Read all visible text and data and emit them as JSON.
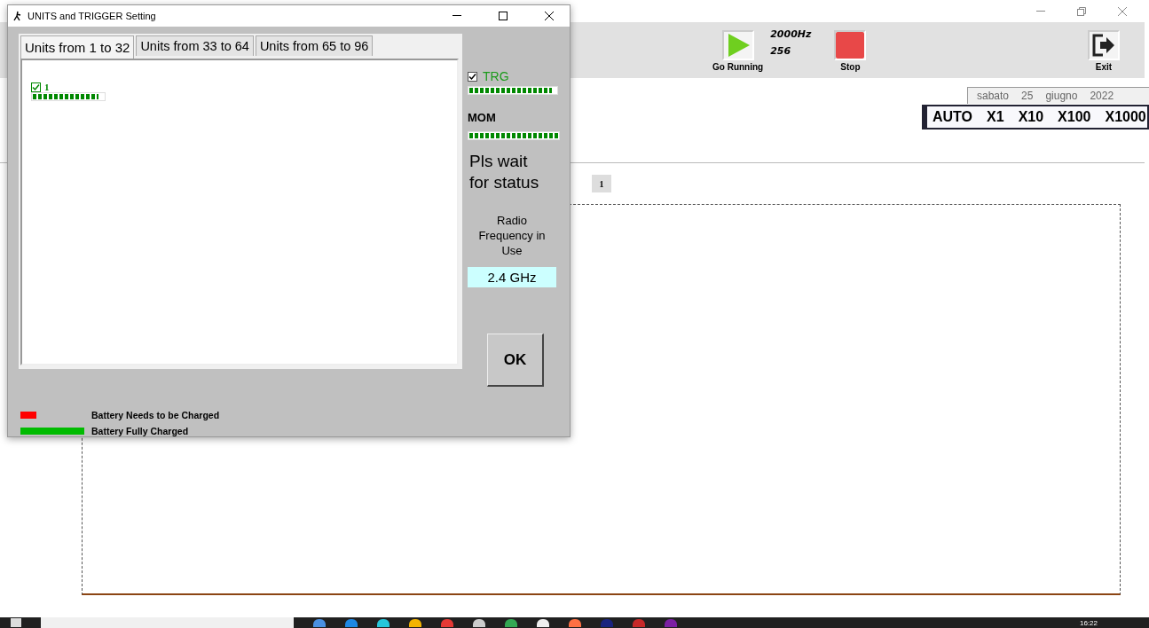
{
  "app": {
    "toolbar": {
      "go_button": "Go Running",
      "rate": "2000Hz",
      "samples": "256",
      "stop_button": "Stop",
      "exit_button": "Exit"
    },
    "date": [
      "sabato",
      "25",
      "giugno",
      "2022"
    ],
    "scale_options": [
      "AUTO",
      "X1",
      "X10",
      "X100",
      "X1000"
    ],
    "channel_tabs": [
      {
        "label": "1",
        "selected": true
      }
    ],
    "taskbar": {
      "clock": "16:22"
    }
  },
  "dialog": {
    "title": "UNITS and TRIGGER Setting",
    "tabs": [
      {
        "label": "Units from 1 to 32",
        "selected": true
      },
      {
        "label": "Units from 33 to 64",
        "selected": false
      },
      {
        "label": "Units from 65 to 96",
        "selected": false
      }
    ],
    "units": [
      {
        "label": "1",
        "checked": true,
        "level": 0.93
      }
    ],
    "trigger": {
      "label": "TRG",
      "checked": true,
      "level": 0.95
    },
    "mom": {
      "label": "MOM",
      "level": 1.0
    },
    "status": "Pls wait for status",
    "radio_label": "Radio Frequency in Use",
    "frequency": "2.4 GHz",
    "ok_button": "OK",
    "legend": [
      {
        "label": "Battery Needs to be Charged",
        "color": "#ff0000",
        "kind": "low"
      },
      {
        "label": "Battery Fully Charged",
        "color": "#00bb00",
        "kind": "full"
      }
    ]
  }
}
